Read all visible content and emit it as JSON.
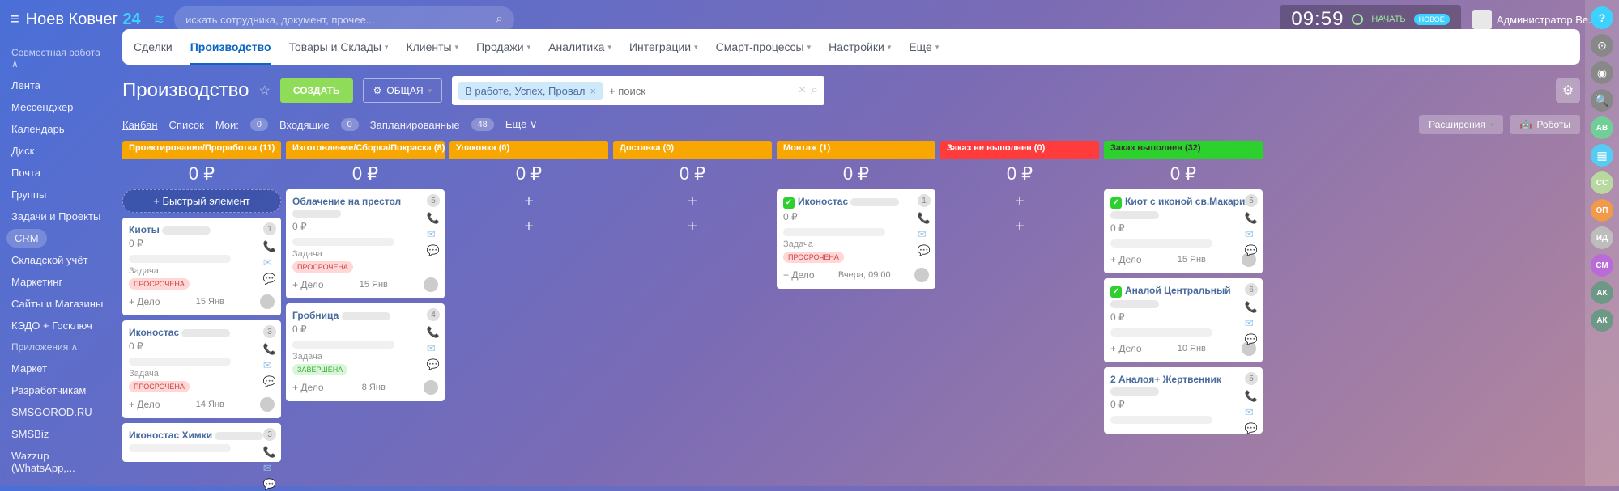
{
  "header": {
    "brand": "Ноев Ковчег ",
    "brand24": "24",
    "search_placeholder": "искать сотрудника, документ, прочее...",
    "clock": "09:59",
    "start": "НАЧАТЬ",
    "new_badge": "НОВОЕ",
    "user": "Администратор Ве..."
  },
  "left_sidebar": {
    "heads": [
      "Совместная работа ∧",
      "Приложения ∧"
    ],
    "items1": [
      "Лента",
      "Мессенджер",
      "Календарь",
      "Диск",
      "Почта",
      "Группы",
      "Задачи и Проекты",
      "CRM",
      "Складской учёт",
      "Маркетинг",
      "Сайты и Магазины",
      "КЭДО + Госключ"
    ],
    "items2": [
      "Маркет",
      "Разработчикам",
      "SMSGOROD.RU",
      "SMSBiz",
      "Wazzup (WhatsApp,..."
    ]
  },
  "tabs": [
    "Сделки",
    "Производство",
    "Товары и Склады",
    "Клиенты",
    "Продажи",
    "Аналитика",
    "Интеграции",
    "Смарт-процессы",
    "Настройки",
    "Еще"
  ],
  "page": {
    "title": "Производство",
    "create": "СОЗДАТЬ",
    "general": "ОБЩАЯ",
    "filter_chip": "В работе, Успех, Провал",
    "search_placeholder": "+ поиск"
  },
  "viewbar": {
    "kanban": "Канбан",
    "list": "Список",
    "mine": "Мои:",
    "mine_count": "0",
    "incoming": "Входящие",
    "planned_count": "0",
    "planned": "Запланированные",
    "more_count": "48",
    "more": "Ещё ∨",
    "ext": "Расширения",
    "robots": "Роботы"
  },
  "columns": [
    {
      "title": "Проектирование/Проработка (11)",
      "color": "orange",
      "sum": "0 ₽",
      "quick": true
    },
    {
      "title": "Изготовление/Сборка/Покраска (8)",
      "color": "orange",
      "sum": "0 ₽"
    },
    {
      "title": "Упаковка (0)",
      "color": "orange",
      "sum": "0 ₽",
      "empty": true
    },
    {
      "title": "Доставка (0)",
      "color": "orange",
      "sum": "0 ₽",
      "empty": true
    },
    {
      "title": "Монтаж (1)",
      "color": "orange",
      "sum": "0 ₽"
    },
    {
      "title": "Заказ не выполнен (0)",
      "color": "red",
      "sum": "0 ₽",
      "empty": true
    },
    {
      "title": "Заказ выполнен (32)",
      "color": "green",
      "sum": "0 ₽"
    }
  ],
  "cards": {
    "c0": [
      {
        "title": "Киоты",
        "amount": "0 ₽",
        "badge": "1",
        "task": "Задача",
        "tag": "ПРОСРОЧЕНА",
        "add": "+ Дело",
        "date": "15 Янв"
      },
      {
        "title": "Иконостас",
        "amount": "0 ₽",
        "badge": "3",
        "task": "Задача",
        "tag": "ПРОСРОЧЕНА",
        "add": "+ Дело",
        "date": "14 Янв"
      },
      {
        "title": "Иконостас Химки",
        "amount": "",
        "badge": "3"
      }
    ],
    "c1": [
      {
        "title": "Облачение на престол",
        "amount": "0 ₽",
        "badge": "5",
        "task": "Задача",
        "tag": "ПРОСРОЧЕНА",
        "add": "+ Дело",
        "date": "15 Янв"
      },
      {
        "title": "Гробница",
        "amount": "0 ₽",
        "badge": "4",
        "task": "Задача",
        "tag": "ЗАВЕРШЕНА",
        "tag_done": true,
        "add": "+ Дело",
        "date": "8 Янв"
      }
    ],
    "c4": [
      {
        "title": "Иконостас",
        "check": true,
        "amount": "0 ₽",
        "badge": "1",
        "task": "Задача",
        "tag": "ПРОСРОЧЕНА",
        "add": "+ Дело",
        "date": "Вчера, 09:00"
      }
    ],
    "c6": [
      {
        "title": "Киот с иконой св.Макария",
        "check": true,
        "amount": "0 ₽",
        "badge": "5",
        "add": "+ Дело",
        "date": "15 Янв"
      },
      {
        "title": "Аналой Центральный",
        "check": true,
        "amount": "0 ₽",
        "badge": "6",
        "add": "+ Дело",
        "date": "10 Янв"
      },
      {
        "title": "2 Аналоя+ Жертвенник",
        "amount": "0 ₽",
        "badge": "5"
      }
    ]
  },
  "labels": {
    "quick": "+  Быстрый элемент",
    "plus": "+"
  },
  "rail": [
    {
      "cls": "rail-q",
      "txt": "?"
    },
    {
      "txt": "⊙",
      "bg": "#888"
    },
    {
      "txt": "◉",
      "bg": "#888"
    },
    {
      "txt": "🔍",
      "bg": "#888"
    },
    {
      "txt": "АВ",
      "bg": "#6fcf97",
      "cls": "rail-av"
    },
    {
      "txt": "▦",
      "bg": "#56ccf2"
    },
    {
      "txt": "СС",
      "bg": "#b8d89f",
      "cls": "rail-av"
    },
    {
      "txt": "ОП",
      "bg": "#f2994a",
      "cls": "rail-av"
    },
    {
      "txt": "ИД",
      "bg": "#bdbdbd",
      "cls": "rail-av"
    },
    {
      "txt": "СМ",
      "bg": "#bb6bd9",
      "cls": "rail-av"
    },
    {
      "txt": "АК",
      "bg": "#6d9886",
      "cls": "rail-av"
    },
    {
      "txt": "АК",
      "bg": "#6d9886",
      "cls": "rail-av"
    }
  ]
}
